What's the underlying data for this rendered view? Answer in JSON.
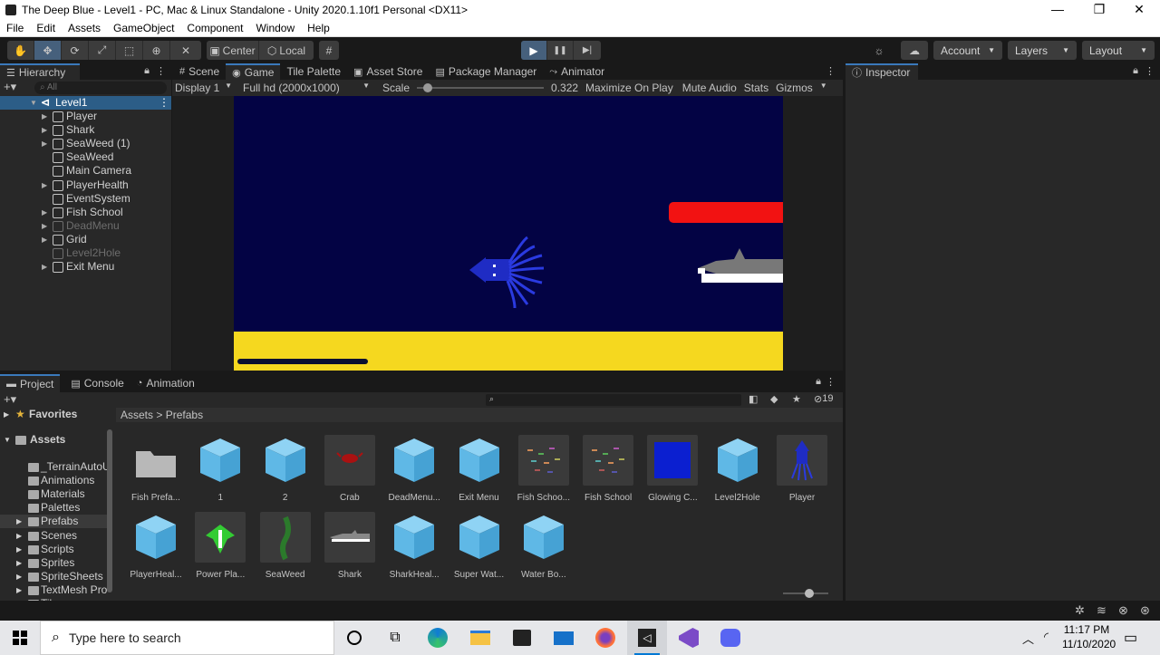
{
  "window": {
    "title": "The Deep Blue - Level1 - PC, Mac & Linux Standalone - Unity 2020.1.10f1 Personal <DX11>",
    "minimize": "—",
    "maximize": "❐",
    "close": "✕"
  },
  "menu": [
    "File",
    "Edit",
    "Assets",
    "GameObject",
    "Component",
    "Window",
    "Help"
  ],
  "toolbar": {
    "pivot_label": "Center",
    "space_label": "Local",
    "play": "▶",
    "pause": "❚❚",
    "step": "▶|",
    "account_label": "Account",
    "layers_label": "Layers",
    "layout_label": "Layout"
  },
  "hierarchy": {
    "tab_label": "Hierarchy",
    "search_placeholder": "All",
    "scene_name": "Level1",
    "items": [
      {
        "label": "Player",
        "expandable": true,
        "dim": false
      },
      {
        "label": "Shark",
        "expandable": true,
        "dim": false
      },
      {
        "label": "SeaWeed (1)",
        "expandable": true,
        "dim": false
      },
      {
        "label": "SeaWeed",
        "expandable": false,
        "dim": false
      },
      {
        "label": "Main Camera",
        "expandable": false,
        "dim": false
      },
      {
        "label": "PlayerHealth",
        "expandable": true,
        "dim": false
      },
      {
        "label": "EventSystem",
        "expandable": false,
        "dim": false
      },
      {
        "label": "Fish School",
        "expandable": true,
        "dim": false
      },
      {
        "label": "DeadMenu",
        "expandable": true,
        "dim": true
      },
      {
        "label": "Grid",
        "expandable": true,
        "dim": false
      },
      {
        "label": "Level2Hole",
        "expandable": false,
        "dim": true
      },
      {
        "label": "Exit Menu",
        "expandable": true,
        "dim": false
      }
    ]
  },
  "center_tabs": {
    "scene": "Scene",
    "game": "Game",
    "tile_palette": "Tile Palette",
    "asset_store": "Asset Store",
    "package_manager": "Package Manager",
    "animator": "Animator"
  },
  "game_bar": {
    "display": "Display 1",
    "resolution": "Full hd (2000x1000)",
    "scale_label": "Scale",
    "scale_value": "0.322",
    "scale_fraction": 0.05,
    "maximize": "Maximize On Play",
    "mute": "Mute Audio",
    "stats": "Stats",
    "gizmos": "Gizmos"
  },
  "inspector": {
    "tab_label": "Inspector"
  },
  "bottom_tabs": {
    "project": "Project",
    "console": "Console",
    "animation": "Animation"
  },
  "project": {
    "hidden_count": "19",
    "favorites_label": "Favorites",
    "assets_label": "Assets",
    "folders": [
      "_TerrainAutoU",
      "Animations",
      "Materials",
      "Palettes",
      "Prefabs",
      "Scenes",
      "Scripts",
      "Sprites",
      "SpriteSheets",
      "TextMesh Pro",
      "Tiles"
    ],
    "breadcrumb_root": "Assets",
    "breadcrumb_sep": ">",
    "breadcrumb_current": "Prefabs",
    "assets_row1": [
      "Fish Prefa...",
      "1",
      "2",
      "Crab",
      "DeadMenu...",
      "Exit Menu",
      "Fish Schoo...",
      "Fish School",
      "Glowing C...",
      "Level2Hole",
      "Player"
    ],
    "assets_row2": [
      "PlayerHeal...",
      "Power Pla...",
      "SeaWeed",
      "Shark",
      "SharkHeal...",
      "Super Wat...",
      "Water Bo..."
    ]
  },
  "taskbar": {
    "search_placeholder": "Type here to search",
    "time": "11:17 PM",
    "date": "11/10/2020"
  },
  "colors": {
    "accent": "#3a79bb",
    "selection": "#2c5d87",
    "game_water": "#030344",
    "sand": "#f5d81f",
    "health_red": "#f21212",
    "cube_blue": "#5fb8e6"
  }
}
